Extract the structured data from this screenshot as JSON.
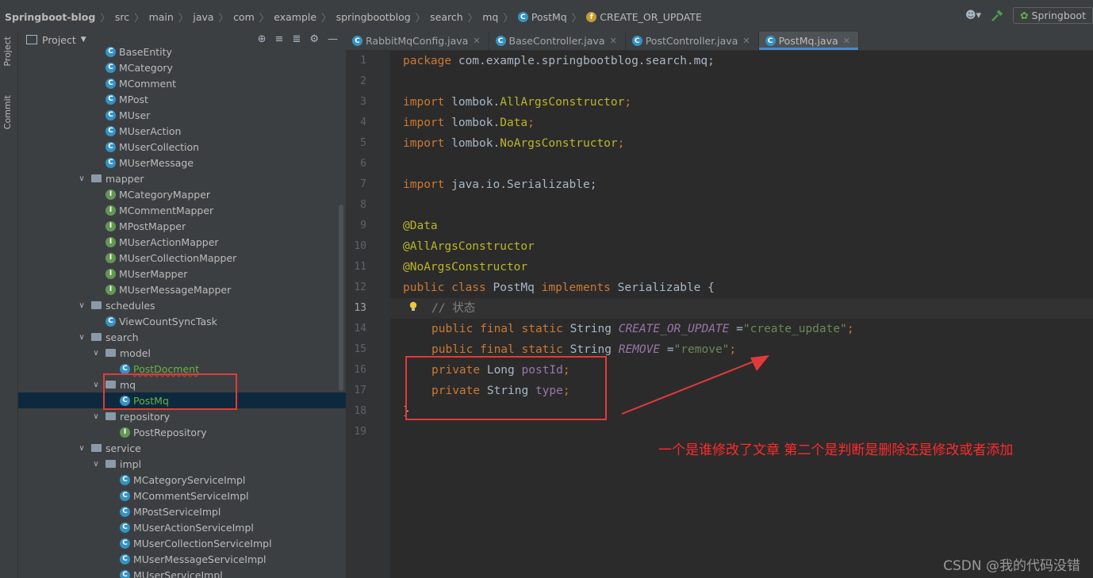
{
  "breadcrumbs": [
    "Springboot-blog",
    "src",
    "main",
    "java",
    "com",
    "example",
    "springbootblog",
    "search",
    "mq",
    "PostMq",
    "CREATE_OR_UPDATE"
  ],
  "run_config": "Springboot",
  "side_tabs": {
    "project": "Project",
    "commit": "Commit"
  },
  "project_panel": {
    "title": "Project"
  },
  "tree": [
    {
      "label": "BaseEntity",
      "type": "class",
      "depth": 3
    },
    {
      "label": "MCategory",
      "type": "class",
      "depth": 3
    },
    {
      "label": "MComment",
      "type": "class",
      "depth": 3
    },
    {
      "label": "MPost",
      "type": "class",
      "depth": 3
    },
    {
      "label": "MUser",
      "type": "class",
      "depth": 3
    },
    {
      "label": "MUserAction",
      "type": "class",
      "depth": 3
    },
    {
      "label": "MUserCollection",
      "type": "class",
      "depth": 3
    },
    {
      "label": "MUserMessage",
      "type": "class",
      "depth": 3
    },
    {
      "label": "mapper",
      "type": "folder",
      "depth": 2
    },
    {
      "label": "MCategoryMapper",
      "type": "interface",
      "depth": 3
    },
    {
      "label": "MCommentMapper",
      "type": "interface",
      "depth": 3
    },
    {
      "label": "MPostMapper",
      "type": "interface",
      "depth": 3
    },
    {
      "label": "MUserActionMapper",
      "type": "interface",
      "depth": 3
    },
    {
      "label": "MUserCollectionMapper",
      "type": "interface",
      "depth": 3
    },
    {
      "label": "MUserMapper",
      "type": "interface",
      "depth": 3
    },
    {
      "label": "MUserMessageMapper",
      "type": "interface",
      "depth": 3
    },
    {
      "label": "schedules",
      "type": "folder",
      "depth": 2
    },
    {
      "label": "ViewCountSyncTask",
      "type": "class",
      "depth": 3
    },
    {
      "label": "search",
      "type": "folder",
      "depth": 2
    },
    {
      "label": "model",
      "type": "folder",
      "depth": 3
    },
    {
      "label": "PostDocment",
      "type": "class",
      "depth": 4,
      "modified": true
    },
    {
      "label": "mq",
      "type": "folder",
      "depth": 3
    },
    {
      "label": "PostMq",
      "type": "class",
      "depth": 4,
      "modified": true,
      "selected": true
    },
    {
      "label": "repository",
      "type": "folder",
      "depth": 3
    },
    {
      "label": "PostRepository",
      "type": "interface",
      "depth": 4
    },
    {
      "label": "service",
      "type": "folder",
      "depth": 2
    },
    {
      "label": "impl",
      "type": "folder",
      "depth": 3
    },
    {
      "label": "MCategoryServiceImpl",
      "type": "class",
      "depth": 4
    },
    {
      "label": "MCommentServiceImpl",
      "type": "class",
      "depth": 4
    },
    {
      "label": "MPostServiceImpl",
      "type": "class",
      "depth": 4
    },
    {
      "label": "MUserActionServiceImpl",
      "type": "class",
      "depth": 4
    },
    {
      "label": "MUserCollectionServiceImpl",
      "type": "class",
      "depth": 4
    },
    {
      "label": "MUserMessageServiceImpl",
      "type": "class",
      "depth": 4
    },
    {
      "label": "MUserServiceImpl",
      "type": "class",
      "depth": 4
    }
  ],
  "tabs": [
    {
      "label": "RabbitMqConfig.java",
      "active": false
    },
    {
      "label": "BaseController.java",
      "active": false
    },
    {
      "label": "PostController.java",
      "active": false
    },
    {
      "label": "PostMq.java",
      "active": true
    }
  ],
  "line_numbers": [
    "1",
    "2",
    "3",
    "4",
    "5",
    "6",
    "7",
    "8",
    "9",
    "10",
    "11",
    "12",
    "13",
    "14",
    "15",
    "16",
    "17",
    "18",
    "19"
  ],
  "code": {
    "l1_kw": "package",
    "l1_rest": " com.example.springbootblog.search.mq;",
    "import_kw": "import",
    "l3_pkg": " lombok.",
    "l3_cls": "AllArgsConstructor",
    "l3_end": ";",
    "l4_pkg": " lombok.",
    "l4_cls": "Data",
    "l4_end": ";",
    "l5_pkg": " lombok.",
    "l5_cls": "NoArgsConstructor",
    "l5_end": ";",
    "l7_rest": " java.io.Serializable;",
    "l9": "@Data",
    "l10": "@AllArgsConstructor",
    "l11": "@NoArgsConstructor",
    "l12_kw1": "public class",
    "l12_name": " PostMq ",
    "l12_kw2": "implements",
    "l12_rest": " Serializable {",
    "l13": "// 状态",
    "l14_kw": "public final static",
    "l14_type": " String ",
    "l14_field": "CREATE_OR_UPDATE",
    "l14_eq": " =",
    "l14_str": "\"create_update\"",
    "l14_end": ";",
    "l15_kw": "public final static",
    "l15_type": " String ",
    "l15_field": "REMOVE",
    "l15_eq": " =",
    "l15_str": "\"remove\"",
    "l15_end": ";",
    "l16_kw": "private",
    "l16_type": " Long ",
    "l16_field": "postId",
    "l16_end": ";",
    "l17_kw": "private",
    "l17_type": " String ",
    "l17_field": "type",
    "l17_end": ";",
    "l18": "}"
  },
  "annotation_note": "一个是谁修改了文章 第二个是判断是删除还是修改或者添加",
  "watermark": "CSDN @我的代码没错",
  "colors": {
    "annotation_red": "#e43939",
    "note_red": "#ff2a2a",
    "selection": "#0d293e",
    "tab_underline": "#4a88c7"
  }
}
